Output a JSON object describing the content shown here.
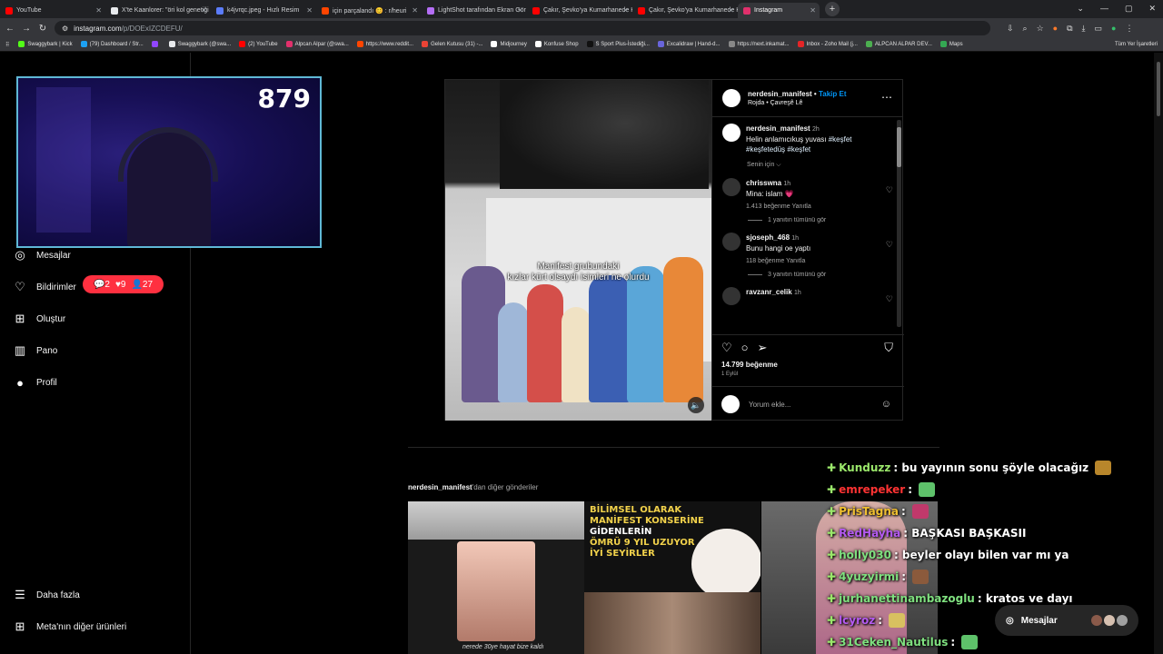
{
  "browser": {
    "tabs": [
      {
        "label": "YouTube",
        "color": "#ff0000",
        "active": false
      },
      {
        "label": "X'te Kaanlorer: \"öri kol genetiği !",
        "color": "#e8eaed",
        "active": false
      },
      {
        "label": "k4jvrqc.jpeg - Hızlı Resim",
        "color": "#5b7cfa",
        "active": false
      },
      {
        "label": "için parçalandı 😊 : r/heuri",
        "color": "#ff4500",
        "active": false
      },
      {
        "label": "LightShot tarafından Ekran Gör",
        "color": "#b46ef5",
        "active": false
      },
      {
        "label": "Çakır, Şevko'ya Kumarhanede K",
        "color": "#ff0000",
        "active": false
      },
      {
        "label": "Çakır, Şevko'ya Kumarhanede K",
        "color": "#ff0000",
        "active": false
      },
      {
        "label": "Instagram",
        "color": "#e1306c",
        "active": true
      }
    ],
    "new_tab": "+",
    "address": {
      "host": "instagram.com",
      "path": "/p/DOExIZCDEFU/"
    },
    "bookmarks": [
      {
        "label": "Swaggybark | Kick",
        "color": "#53fc18"
      },
      {
        "label": "(79) Dashboard / Str...",
        "color": "#1da1f2"
      },
      {
        "label": "",
        "color": "#9146ff"
      },
      {
        "label": "Swaggybark (@swa...",
        "color": "#e8eaed"
      },
      {
        "label": "(2) YouTube",
        "color": "#ff0000"
      },
      {
        "label": "Alpcan Alpar (@swa...",
        "color": "#e1306c"
      },
      {
        "label": "https://www.reddit...",
        "color": "#ff4500"
      },
      {
        "label": "Gelen Kutusu (31) -...",
        "color": "#ea4335"
      },
      {
        "label": "Midjourney",
        "color": "#ffffff"
      },
      {
        "label": "Konfuse Shop",
        "color": "#ffffff"
      },
      {
        "label": "S Sport Plus-İstediği...",
        "color": "#111111"
      },
      {
        "label": "Excalidraw | Hand-d...",
        "color": "#6965db"
      },
      {
        "label": "https://next.inkamat...",
        "color": "#888888"
      },
      {
        "label": "Inbox - Zoho Mail (j...",
        "color": "#e42527"
      },
      {
        "label": "ALPCAN ALPAR DEV...",
        "color": "#4caf50"
      },
      {
        "label": "Maps",
        "color": "#34a853"
      }
    ],
    "all_bookmarks": "Tüm Yer İşaretleri"
  },
  "stream": {
    "viewer_count": "879"
  },
  "sidebar": {
    "items": [
      {
        "label": "Mesajlar",
        "icon": "messenger-icon"
      },
      {
        "label": "Bildirimler",
        "icon": "heart-icon"
      },
      {
        "label": "Oluştur",
        "icon": "plus-square-icon"
      },
      {
        "label": "Pano",
        "icon": "dashboard-icon"
      },
      {
        "label": "Profil",
        "icon": "profile-avatar-icon"
      }
    ],
    "bottom": [
      {
        "label": "Daha fazla",
        "icon": "menu-icon"
      },
      {
        "label": "Meta'nın diğer ürünleri",
        "icon": "apps-grid-icon"
      }
    ],
    "notifications": {
      "comments": "2",
      "likes": "9",
      "follows": "27"
    }
  },
  "post": {
    "username": "nerdesin_manifest",
    "follow": "Takip Et",
    "subtitle": "Rojda • Çavreşê Lê",
    "video_caption_1": "Manifest grubundaki",
    "video_caption_2": "kızlar kürt olsaydı isimleri ne olurdu",
    "caption_user": "nerdesin_manifest",
    "caption_time": "2h",
    "caption_text": "Helin anlamıcıkuş yuvası",
    "caption_tags": "#keşfet #keşfetedüş #keşfet",
    "for_you": "Senin için",
    "comments": [
      {
        "user": "chrisswna",
        "time": "1h",
        "text": "Mina: islam 💗",
        "likes": "1.413 beğenme",
        "reply": "Yanıtla",
        "more": "1 yanıtın tümünü gör"
      },
      {
        "user": "sjoseph_468",
        "time": "1h",
        "text": "Bunu hangi oe yaptı",
        "likes": "118 beğenme",
        "reply": "Yanıtla",
        "more": "3 yanıtın tümünü gör"
      },
      {
        "user": "ravzanr_celik",
        "time": "1h",
        "text": "",
        "likes": "",
        "reply": "",
        "more": ""
      }
    ],
    "like_count": "14.799 beğenme",
    "date": "1 Eylül",
    "add_comment": "Yorum ekle..."
  },
  "more_posts": {
    "user": "nerdesin_manifest",
    "suffix": "'dan diğer gönderiler",
    "thumb1_caption": "nerede 30ye hayat bize kaldı",
    "thumb2_lines": [
      "BİLİMSEL OLARAK",
      "MANİFEST KONSERİNE",
      "GİDENLERİN",
      "ÖMRÜ 9 YIL UZUYOR",
      "İYİ SEYİRLER"
    ]
  },
  "chat": [
    {
      "user": "Kunduzz",
      "color": "#9be86b",
      "msg": ": bu yayının sonu şöyle olacağız",
      "emote": "#b8862b"
    },
    {
      "user": "emrepeker",
      "color": "#ff3333",
      "msg": ":",
      "emote": "#5ec16a"
    },
    {
      "user": "PrisTagna",
      "color": "#f0c030",
      "msg": ":",
      "emote": "#c0396b"
    },
    {
      "user": "RedHayha",
      "color": "#b45af0",
      "msg": ": BAŞKASI BAŞKASII",
      "emote": ""
    },
    {
      "user": "holly030",
      "color": "#7fe07f",
      "msg": ": beyler olayı bilen var mı ya",
      "emote": ""
    },
    {
      "user": "4yuzyirmi",
      "color": "#7fe07f",
      "msg": ":",
      "emote": "#8b5a3c"
    },
    {
      "user": "jurhanettinambazoglu",
      "color": "#7fe07f",
      "msg": ": kratos ve dayı",
      "emote": ""
    },
    {
      "user": "lcyroz",
      "color": "#b45af0",
      "msg": ":",
      "emote": "#d8c060"
    },
    {
      "user": "31Ceken_Nautilus",
      "color": "#7fe07f",
      "msg": ":",
      "emote": "#5ec16a"
    }
  ],
  "dm_button": {
    "label": "Mesajlar"
  }
}
